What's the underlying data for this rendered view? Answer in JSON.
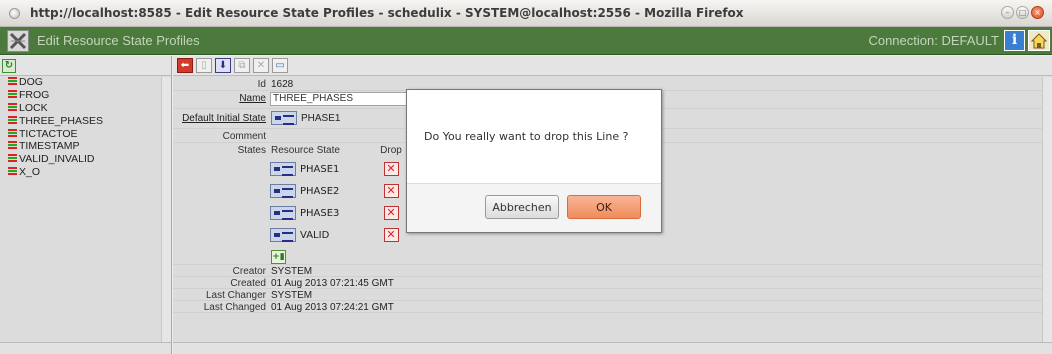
{
  "window": {
    "title": "http://localhost:8585 - Edit Resource State Profiles - schedulix - SYSTEM@localhost:2556 - Mozilla Firefox"
  },
  "app": {
    "title": "Edit Resource State Profiles",
    "connection": "Connection: DEFAULT"
  },
  "tree": {
    "items": [
      "DOG",
      "FROG",
      "LOCK",
      "THREE_PHASES",
      "TICTACTOE",
      "TIMESTAMP",
      "VALID_INVALID",
      "X_O"
    ]
  },
  "form": {
    "id_label": "Id",
    "id_value": "1628",
    "name_label": "Name",
    "name_value": "THREE_PHASES",
    "default_state_label": "Default Initial State",
    "default_state_value": "PHASE1",
    "comment_label": "Comment",
    "states_label": "States",
    "states_col_resource_state": "Resource State",
    "states_col_drop": "Drop",
    "states": [
      "PHASE1",
      "PHASE2",
      "PHASE3",
      "VALID"
    ],
    "creator_label": "Creator",
    "creator_value": "SYSTEM",
    "created_label": "Created",
    "created_value": "01 Aug 2013 07:21:45 GMT",
    "last_changer_label": "Last Changer",
    "last_changer_value": "SYSTEM",
    "last_changed_label": "Last Changed",
    "last_changed_value": "01 Aug 2013 07:24:21 GMT"
  },
  "dialog": {
    "message": "Do You really want to drop this Line ?",
    "cancel_label": "Abbrechen",
    "ok_label": "OK"
  },
  "colors": {
    "app_header": "#4b7a3c",
    "ok_button": "#f08c5c"
  }
}
